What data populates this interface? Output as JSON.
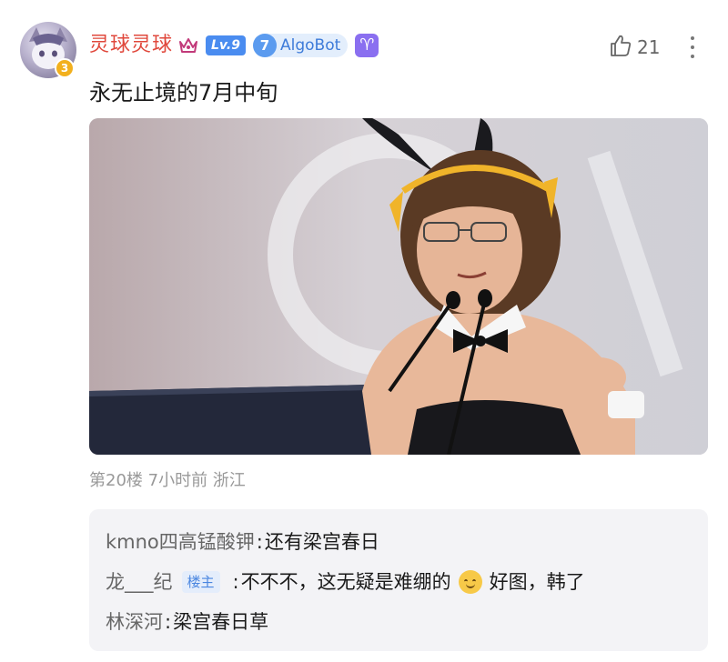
{
  "post": {
    "username": "灵球灵球",
    "level_badge": "Lv.9",
    "bot_badge_num": "7",
    "bot_badge_label": "AlgoBot",
    "avatar_level": "3",
    "like_count": "21",
    "text": "永无止境的7月中旬",
    "meta": "第20楼 7小时前 浙江"
  },
  "replies": [
    {
      "name": "kmno四高锰酸钾",
      "sep": ":",
      "text": "还有梁宫春日"
    },
    {
      "name": "龙___纪",
      "badge": "楼主",
      "sep": ":",
      "text_before_emoji": "不不不，这无疑是难绷的",
      "emoji": "smiling-face-emoji",
      "text_after_emoji": "好图，韩了"
    },
    {
      "name": "林深河",
      "sep": ":",
      "text": "梁宫春日草"
    }
  ],
  "icons": {
    "crown": "crown-icon",
    "aries": "♈",
    "like": "thumbs-up-icon",
    "more": "more-vertical-icon"
  },
  "colors": {
    "username": "#e0483c",
    "level_badge": "#4a8cf0",
    "bot_badge_bg": "#e3eefc",
    "reply_bg": "#f3f3f6"
  }
}
